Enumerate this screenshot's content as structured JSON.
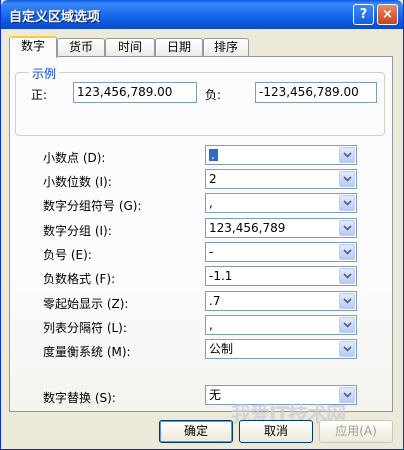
{
  "window": {
    "title": "自定义区域选项",
    "help_label": "?",
    "close_label": "×"
  },
  "tabs": [
    {
      "label": "数字",
      "active": true
    },
    {
      "label": "货币"
    },
    {
      "label": "时间"
    },
    {
      "label": "日期"
    },
    {
      "label": "排序"
    }
  ],
  "example": {
    "group_label": "示例",
    "positive_label": "正:",
    "positive_value": "123,456,789.00",
    "negative_label": "负:",
    "negative_value": "-123,456,789.00"
  },
  "fields": [
    {
      "label": "小数点 (D):",
      "value": "."
    },
    {
      "label": "小数位数 (I):",
      "value": "2"
    },
    {
      "label": "数字分组符号 (G):",
      "value": ","
    },
    {
      "label": "数字分组 (I):",
      "value": "123,456,789"
    },
    {
      "label": "负号 (E):",
      "value": "-"
    },
    {
      "label": "负数格式 (F):",
      "value": "-1.1"
    },
    {
      "label": "零起始显示 (Z):",
      "value": ".7"
    },
    {
      "label": "列表分隔符 (L):",
      "value": ","
    },
    {
      "label": "度量衡系统 (M):",
      "value": "公制"
    },
    {
      "label": "数字替换 (S):",
      "value": "无"
    }
  ],
  "buttons": {
    "ok": "确定",
    "cancel": "取消",
    "apply": "应用(A)"
  },
  "watermark": "我爱IT技术网"
}
